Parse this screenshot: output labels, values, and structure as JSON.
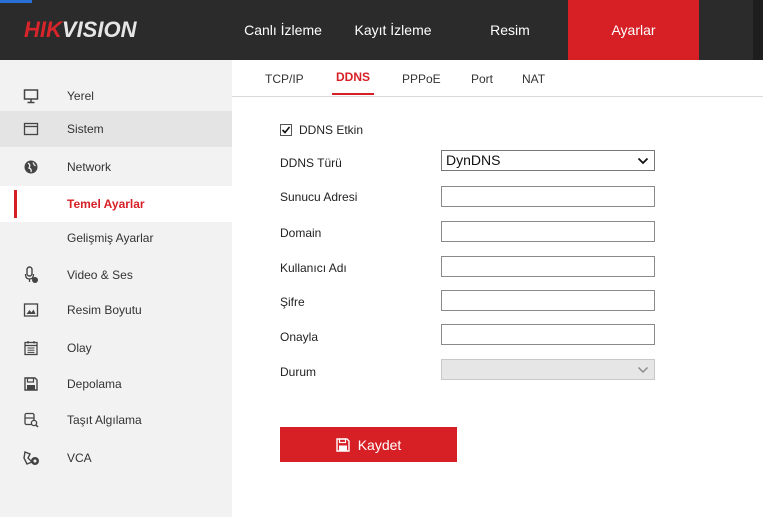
{
  "brand": {
    "hik": "HIK",
    "vision": "VISION"
  },
  "nav": [
    {
      "label": "Canlı İzleme",
      "active": false
    },
    {
      "label": "Kayıt İzleme",
      "active": false
    },
    {
      "label": "Resim",
      "active": false
    },
    {
      "label": "Ayarlar",
      "active": true
    }
  ],
  "sidebar": {
    "items": [
      {
        "label": "Yerel",
        "icon": "monitor-icon"
      },
      {
        "label": "Sistem",
        "icon": "window-icon"
      },
      {
        "label": "Network",
        "icon": "globe-icon"
      },
      {
        "label": "Temel Ayarlar",
        "icon": "",
        "active": true
      },
      {
        "label": "Gelişmiş Ayarlar",
        "icon": ""
      },
      {
        "label": "Video & Ses",
        "icon": "microphone-icon"
      },
      {
        "label": "Resim Boyutu",
        "icon": "image-icon"
      },
      {
        "label": "Olay",
        "icon": "calendar-icon"
      },
      {
        "label": "Depolama",
        "icon": "floppy-icon"
      },
      {
        "label": "Taşıt Algılama",
        "icon": "vehicle-search-icon"
      },
      {
        "label": "VCA",
        "icon": "vca-icon"
      }
    ]
  },
  "tabs": [
    {
      "label": "TCP/IP",
      "active": false
    },
    {
      "label": "DDNS",
      "active": true
    },
    {
      "label": "PPPoE",
      "active": false
    },
    {
      "label": "Port",
      "active": false
    },
    {
      "label": "NAT",
      "active": false
    }
  ],
  "form": {
    "ddns_enabled_label": "DDNS Etkin",
    "ddns_enabled": true,
    "ddns_type_label": "DDNS Türü",
    "ddns_type_value": "DynDNS",
    "server_label": "Sunucu Adresi",
    "server_value": "",
    "domain_label": "Domain",
    "domain_value": "",
    "username_label": "Kullanıcı Adı",
    "username_value": "",
    "password_label": "Şifre",
    "password_value": "",
    "confirm_label": "Onayla",
    "confirm_value": "",
    "status_label": "Durum",
    "status_value": ""
  },
  "save_label": "Kaydet",
  "colors": {
    "accent": "#d71f26",
    "header": "#2b2b2b",
    "sidebar": "#f2f2f2"
  }
}
